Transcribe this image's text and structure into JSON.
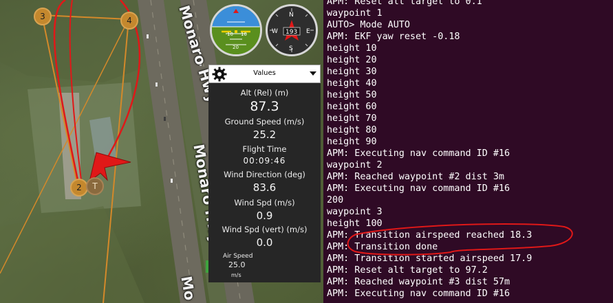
{
  "map": {
    "roads": [
      {
        "label": "Monaro Hwy"
      },
      {
        "label": "Monaro Hwy"
      },
      {
        "label": "Mo"
      }
    ],
    "waypoints": [
      {
        "label": "3"
      },
      {
        "label": "4"
      },
      {
        "label": "2"
      },
      {
        "label": "T"
      }
    ]
  },
  "instruments": {
    "attitude": {
      "pitch_marks": [
        "10",
        "10",
        "20"
      ]
    },
    "heading": {
      "value": "193",
      "cardinal": [
        "N",
        "E",
        "S",
        "W"
      ]
    }
  },
  "quick_view": {
    "header": {
      "title": "Values",
      "icon": "gear-icon",
      "dropdown_icon": "chevron-down-icon"
    },
    "items": [
      {
        "label": "Alt (Rel) (m)",
        "value": "87.3"
      },
      {
        "label": "Ground Speed (m/s)",
        "value": "25.2"
      },
      {
        "label": "Flight Time",
        "value": "00:09:46"
      },
      {
        "label": "Wind Direction (deg)",
        "value": "83.6"
      },
      {
        "label": "Wind Spd (m/s)",
        "value": "0.9"
      },
      {
        "label": "Wind Spd (vert) (m/s)",
        "value": "0.0"
      }
    ],
    "airspeed": {
      "label": "Air Speed",
      "value": "25.0",
      "unit": "m/s"
    }
  },
  "console": {
    "lines": [
      "APM: Reset alt target to 0.1",
      "waypoint 1",
      "AUTO> Mode AUTO",
      "APM: EKF yaw reset -0.18",
      "height 10",
      "height 20",
      "height 30",
      "height 40",
      "height 50",
      "height 60",
      "height 70",
      "height 80",
      "height 90",
      "APM: Executing nav command ID #16",
      "waypoint 2",
      "APM: Reached waypoint #2 dist 3m",
      "APM: Executing nav command ID #16",
      "200",
      "waypoint 3",
      "height 100",
      "APM: Transition airspeed reached 18.3",
      "APM: Transition done",
      "APM: Transition started airspeed 17.9",
      "APM: Reset alt target to 97.2",
      "APM: Reached waypoint #3 dist 57m",
      "APM: Executing nav command ID #16"
    ]
  },
  "colors": {
    "console_bg": "#2f0a25",
    "flight_path": "#e01818",
    "mission_line": "#d4892a",
    "highlight": "#e01818"
  }
}
